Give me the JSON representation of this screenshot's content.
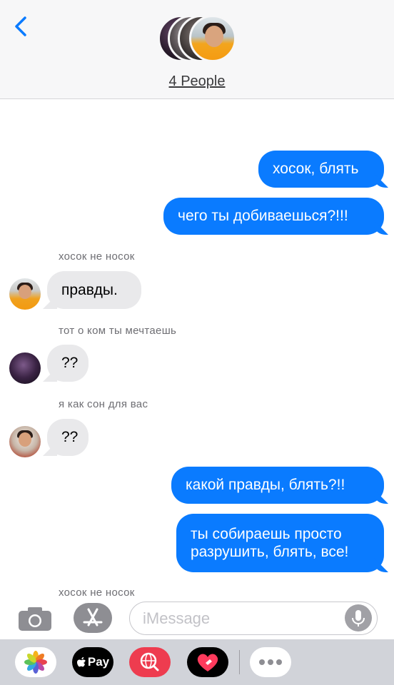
{
  "header": {
    "group_name": "4 People",
    "back_icon": "chevron-left-icon"
  },
  "messages": [
    {
      "side": "out",
      "text": "хосок, блять"
    },
    {
      "side": "out",
      "text": "чего ты добиваешься?!!!"
    },
    {
      "side": "in",
      "sender": "хосок не носок",
      "text": "правды."
    },
    {
      "side": "in",
      "sender": "тот о ком ты мечтаешь",
      "text": "??"
    },
    {
      "side": "in",
      "sender": "я как сон для вас",
      "text": "??"
    },
    {
      "side": "out",
      "text": "какой правды, блять?!!"
    },
    {
      "side": "out",
      "text_line1": "ты собираешь просто",
      "text_line2": "разрушить, блять, все!"
    },
    {
      "sender": "хосок не носок"
    }
  ],
  "input": {
    "placeholder": "iMessage",
    "value": ""
  },
  "apps": {
    "apple_pay_label": "Pay",
    "more_icon": "ellipsis-icon"
  },
  "colors": {
    "outgoing_bubble": "#0a7bff",
    "incoming_bubble": "#e9e9eb",
    "accent": "#0a7bff"
  }
}
